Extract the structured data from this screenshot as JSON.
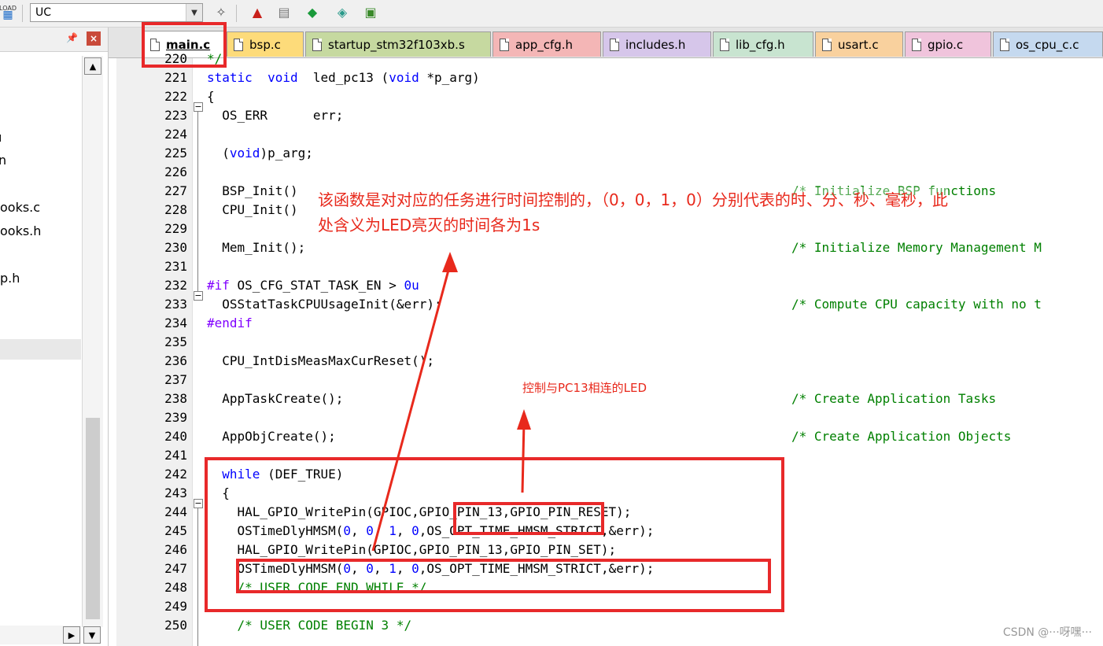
{
  "toolbar": {
    "target": "UC",
    "load_label": "LOAD"
  },
  "left_panel": {
    "items": [
      "ooks.c",
      "ooks.h",
      "p.h"
    ]
  },
  "tabs": [
    {
      "label": "main.c",
      "color": "#ffffff",
      "active": true
    },
    {
      "label": "bsp.c",
      "color": "#fddb7a"
    },
    {
      "label": "startup_stm32f103xb.s",
      "color": "#c6d9a0"
    },
    {
      "label": "app_cfg.h",
      "color": "#f4b6b6"
    },
    {
      "label": "includes.h",
      "color": "#d6c6ea"
    },
    {
      "label": "lib_cfg.h",
      "color": "#c8e4d0"
    },
    {
      "label": "usart.c",
      "color": "#f9d19e"
    },
    {
      "label": "gpio.c",
      "color": "#f0c4dc"
    },
    {
      "label": "os_cpu_c.c",
      "color": "#c5d9ef"
    }
  ],
  "code_lines": [
    {
      "n": "220",
      "code": "*/"
    },
    {
      "n": "221",
      "code": "static  void  led_pc13 (void *p_arg)"
    },
    {
      "n": "222",
      "code": "{"
    },
    {
      "n": "223",
      "code": "  OS_ERR      err;"
    },
    {
      "n": "224",
      "code": ""
    },
    {
      "n": "225",
      "code": "  (void)p_arg;"
    },
    {
      "n": "226",
      "code": ""
    },
    {
      "n": "227",
      "code": "  BSP_Init()",
      "comment": "/* Initialize BSP functions"
    },
    {
      "n": "228",
      "code": "  CPU_Init()"
    },
    {
      "n": "229",
      "code": ""
    },
    {
      "n": "230",
      "code": "  Mem_Init();",
      "comment": "/* Initialize Memory Management M"
    },
    {
      "n": "231",
      "code": ""
    },
    {
      "n": "232",
      "code": "#if OS_CFG_STAT_TASK_EN > 0u"
    },
    {
      "n": "233",
      "code": "  OSStatTaskCPUUsageInit(&err);",
      "comment": "/* Compute CPU capacity with no t"
    },
    {
      "n": "234",
      "code": "#endif"
    },
    {
      "n": "235",
      "code": ""
    },
    {
      "n": "236",
      "code": "  CPU_IntDisMeasMaxCurReset();"
    },
    {
      "n": "237",
      "code": ""
    },
    {
      "n": "238",
      "code": "  AppTaskCreate();",
      "comment": "/* Create Application Tasks"
    },
    {
      "n": "239",
      "code": ""
    },
    {
      "n": "240",
      "code": "  AppObjCreate();",
      "comment": "/* Create Application Objects"
    },
    {
      "n": "241",
      "code": ""
    },
    {
      "n": "242",
      "code": "  while (DEF_TRUE)"
    },
    {
      "n": "243",
      "code": "  {"
    },
    {
      "n": "244",
      "code": "    HAL_GPIO_WritePin(GPIOC,GPIO_PIN_13,GPIO_PIN_RESET);"
    },
    {
      "n": "245",
      "code": "    OSTimeDlyHMSM(0, 0, 1, 0,OS_OPT_TIME_HMSM_STRICT,&err);"
    },
    {
      "n": "246",
      "code": "    HAL_GPIO_WritePin(GPIOC,GPIO_PIN_13,GPIO_PIN_SET);"
    },
    {
      "n": "247",
      "code": "    OSTimeDlyHMSM(0, 0, 1, 0,OS_OPT_TIME_HMSM_STRICT,&err);"
    },
    {
      "n": "248",
      "code": "    /* USER CODE END WHILE */"
    },
    {
      "n": "249",
      "code": ""
    },
    {
      "n": "250",
      "code": "    /* USER CODE BEGIN 3 */"
    }
  ],
  "annotations": {
    "main_note_line1": "该函数是对对应的任务进行时间控制的，（0，0，1，0）分别代表的时、分、秒、毫秒，此",
    "main_note_line2": "处含义为LED亮灭的时间各为1s",
    "led_note": "控制与PC13相连的LED"
  },
  "watermark": "CSDN @···呀嘿···",
  "colors": {
    "annotation_red": "#e8291c",
    "keyword_blue": "#0000ff",
    "comment_green": "#008000",
    "preproc_purple": "#8000ff"
  }
}
